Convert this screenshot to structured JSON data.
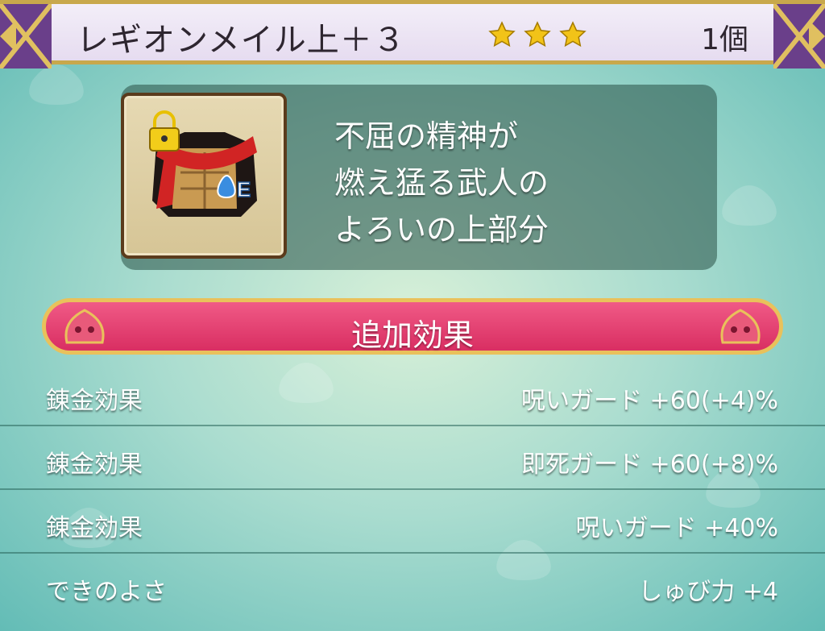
{
  "header": {
    "item_name": "レギオンメイル上＋３",
    "star_count": 3,
    "quantity": "1個"
  },
  "item": {
    "icon": "torso-armor-icon",
    "lock_icon": "lock-icon",
    "equipped_badge": "E",
    "description_lines": [
      "不屈の精神が",
      "燃え猛る武人の",
      "よろいの上部分"
    ]
  },
  "section": {
    "title": "追加効果"
  },
  "effects": [
    {
      "label": "錬金効果",
      "value": "呪いガード +60(+4)%"
    },
    {
      "label": "錬金効果",
      "value": "即死ガード +60(+8)%"
    },
    {
      "label": "錬金効果",
      "value": "呪いガード +40%"
    },
    {
      "label": "できのよさ",
      "value": "しゅび力 +4"
    }
  ],
  "colors": {
    "banner": "#e0386b",
    "gold_border": "#e9c15b",
    "header_bg": "#ece4f4",
    "star": "#f2c318"
  }
}
